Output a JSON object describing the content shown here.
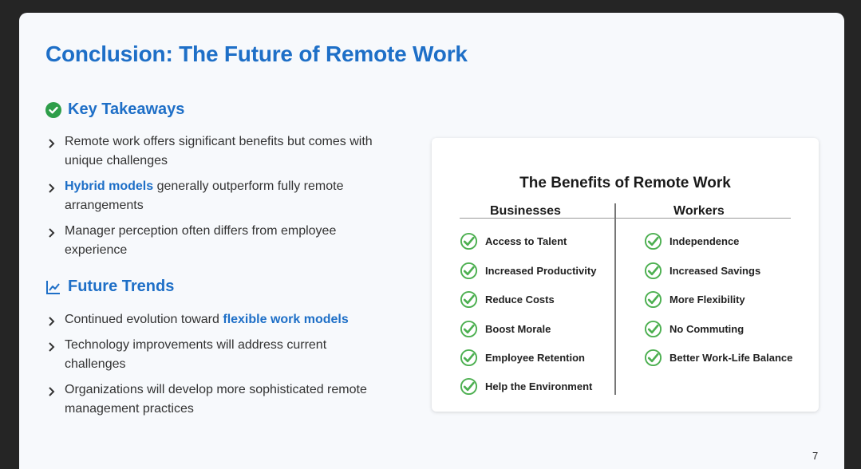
{
  "slide": {
    "title": "Conclusion: The Future of Remote Work",
    "page_number": "7"
  },
  "key_takeaways": {
    "heading": "Key Takeaways",
    "items": [
      {
        "pre": "Remote work offers significant benefits but comes with unique challenges",
        "hl": "",
        "post": ""
      },
      {
        "pre": "",
        "hl": "Hybrid models",
        "post": " generally outperform fully remote arrangements"
      },
      {
        "pre": "Manager perception often differs from employee experience",
        "hl": "",
        "post": ""
      }
    ]
  },
  "future_trends": {
    "heading": "Future Trends",
    "items": [
      {
        "pre": "Continued evolution toward ",
        "hl": "flexible work models",
        "post": ""
      },
      {
        "pre": "Technology improvements will address current challenges",
        "hl": "",
        "post": ""
      },
      {
        "pre": "Organizations will develop more sophisticated remote management practices",
        "hl": "",
        "post": ""
      }
    ]
  },
  "benefits_card": {
    "title": "The Benefits of Remote Work",
    "businesses": {
      "heading": "Businesses",
      "items": [
        "Access to Talent",
        "Increased Productivity",
        "Reduce Costs",
        "Boost Morale",
        "Employee Retention",
        "Help the Environment"
      ]
    },
    "workers": {
      "heading": "Workers",
      "items": [
        "Independence",
        "Increased Savings",
        "More Flexibility",
        "No Commuting",
        "Better Work-Life Balance"
      ]
    }
  },
  "colors": {
    "accent": "#1e6fc7",
    "check_green": "#4caf50"
  },
  "icons": {
    "key_takeaways": "check-circle-icon",
    "future_trends": "trend-line-icon",
    "bullet": "chevron-right-icon",
    "benefit": "check-circle-outline-icon"
  }
}
